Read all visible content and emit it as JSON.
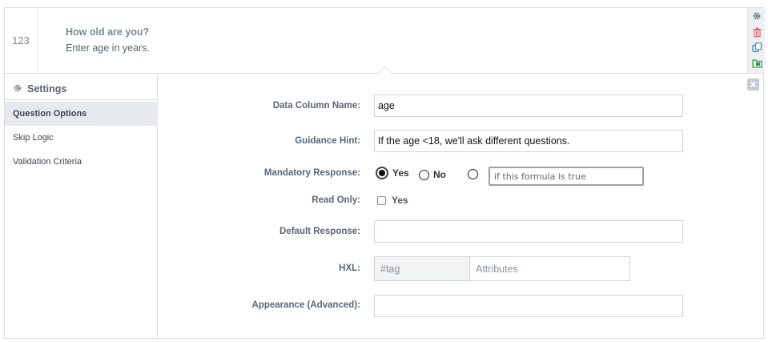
{
  "question": {
    "type_label": "123",
    "label": "How old are you?",
    "hint": "Enter age in years."
  },
  "toolbar": {
    "icons": [
      "gear-icon",
      "trash-icon",
      "duplicate-icon",
      "add-to-library-icon"
    ]
  },
  "sidebar": {
    "title": "Settings",
    "items": [
      {
        "label": "Question Options",
        "active": true
      },
      {
        "label": "Skip Logic",
        "active": false
      },
      {
        "label": "Validation Criteria",
        "active": false
      }
    ]
  },
  "form": {
    "data_column_name": {
      "label": "Data Column Name:",
      "value": "age"
    },
    "guidance_hint": {
      "label": "Guidance Hint:",
      "value": "If the age <18, we'll ask different questions."
    },
    "mandatory": {
      "label": "Mandatory Response:",
      "options": [
        "Yes",
        "No"
      ],
      "selected": "Yes",
      "formula_placeholder": "if this formula is true"
    },
    "read_only": {
      "label": "Read Only:",
      "option": "Yes",
      "checked": false
    },
    "default_response": {
      "label": "Default Response:",
      "value": ""
    },
    "hxl": {
      "label": "HXL:",
      "tag_placeholder": "#tag",
      "attributes_placeholder": "Attributes"
    },
    "appearance": {
      "label": "Appearance (Advanced):",
      "value": ""
    }
  },
  "colors": {
    "border": "#d9dde3",
    "sidebar_active_bg": "#e6e9ed",
    "label_text": "#5c6675",
    "duplicate_icon": "#1f8fd6",
    "trash_icon": "#e05c5c",
    "library_icon": "#2e9a4a"
  }
}
